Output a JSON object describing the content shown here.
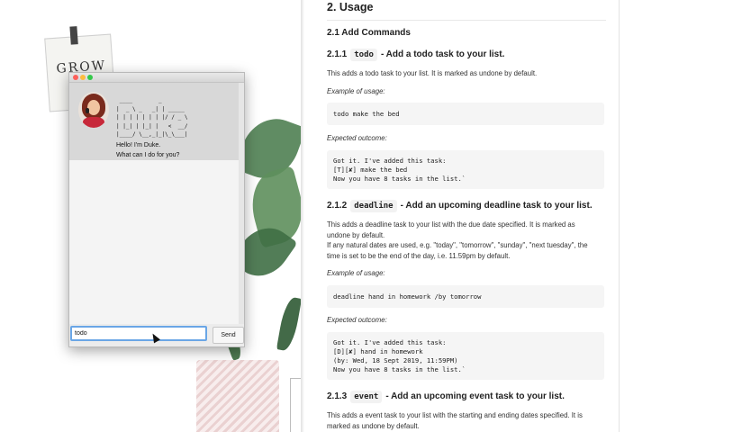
{
  "wallpaper": {
    "note_text": "GROW"
  },
  "duke_window": {
    "logo_lines": [
      " ____        _        ",
      "|  _ \\ _   _| | _____ ",
      "| | | | | | | |/ / _ \\",
      "| |_| | |_| |   <  __/",
      "|____/ \\__,_|_|\\_\\___|"
    ],
    "greeting_line1": "Hello! I'm Duke.",
    "greeting_line2": "What can I do for you?",
    "input_value": "todo",
    "send_label": "Send"
  },
  "doc": {
    "section_title": "2. Usage",
    "subsection_title": "2.1 Add Commands",
    "todo": {
      "num": "2.1.1",
      "cmd": "todo",
      "title": "- Add a todo task to your list.",
      "desc": "This adds a todo task to your list. It is marked as undone by default.",
      "example_label": "Example of usage:",
      "example_code": "todo make the bed",
      "outcome_label": "Expected outcome:",
      "outcome_code": "Got it. I've added this task:\n[T][✘] make the bed\nNow you have 8 tasks in the list.`"
    },
    "deadline": {
      "num": "2.1.2",
      "cmd": "deadline",
      "title": "- Add an upcoming deadline task to your list.",
      "desc1": "This adds a deadline task to your list with the due date specified. It is marked as undone by default.",
      "desc2": "If any natural dates are used, e.g. \"today\", \"tomorrow\", \"sunday\", \"next tuesday\", the time is set to be the end of the day, i.e. 11.59pm by default.",
      "example_label": "Example of usage:",
      "example_code": "deadline hand in homework /by tomorrow",
      "outcome_label": "Expected outcome:",
      "outcome_code": "Got it. I've added this task:\n[D][✘] hand in homework\n(by: Wed, 18 Sept 2019, 11:59PM)\nNow you have 8 tasks in the list.`"
    },
    "event": {
      "num": "2.1.3",
      "cmd": "event",
      "title": "- Add an upcoming event task to your list.",
      "desc": "This adds a event task to your list with the starting and ending dates specified. It is marked as undone by default."
    }
  }
}
